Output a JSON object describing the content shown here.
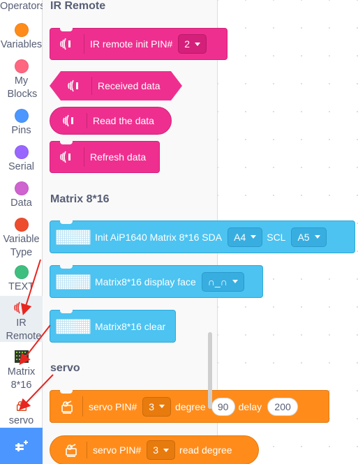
{
  "sidebar": {
    "categories": [
      {
        "label": "Operators",
        "color": "#59c059"
      },
      {
        "label": "Variables",
        "color": "#ff8c1a"
      },
      {
        "label": "My Blocks",
        "color": "#ff6680"
      },
      {
        "label": "Pins",
        "color": "#4c97ff"
      },
      {
        "label": "Serial",
        "color": "#9966ff"
      },
      {
        "label": "Data",
        "color": "#cf63cf"
      },
      {
        "label": "Variable Type",
        "color": "#ee4d2d"
      },
      {
        "label": "TEXT",
        "color": "#3fbf7f"
      },
      {
        "label": "IR Remote",
        "icon": "ir-remote-icon"
      },
      {
        "label": "Matrix 8*16",
        "icon": "led-matrix-icon"
      },
      {
        "label": "servo",
        "icon": "servo-icon"
      }
    ],
    "extension_icon": "add-extension-icon"
  },
  "flyout": {
    "ir_section_title": "IR Remote",
    "ir_blocks": {
      "init_label": "IR remote init PIN#",
      "init_pin": "2",
      "received_label": "Received data",
      "read_label": "Read the data",
      "refresh_label": "Refresh data"
    },
    "matrix_section_title": "Matrix 8*16",
    "matrix_blocks": {
      "init_label": "Init AiP1640 Matrix 8*16 SDA",
      "sda_value": "A4",
      "scl_label": "SCL",
      "scl_value": "A5",
      "display_label": "Matrix8*16 display face",
      "face_value": "∩_∩",
      "clear_label": "Matrix8*16 clear"
    },
    "servo_section_title": "servo",
    "servo_blocks": {
      "write_label": "servo PIN#",
      "write_pin": "3",
      "degree_label": "degree",
      "degree_value": "90",
      "delay_label": "delay",
      "delay_value": "200",
      "read_label": "servo PIN#",
      "read_pin": "3",
      "read_degree_label": "read degree"
    }
  },
  "colors": {
    "ir_block": "#ef2f8f",
    "matrix_block": "#4cc3f1",
    "servo_block": "#ff8c1a",
    "annotation_arrows": "#e8251f"
  }
}
